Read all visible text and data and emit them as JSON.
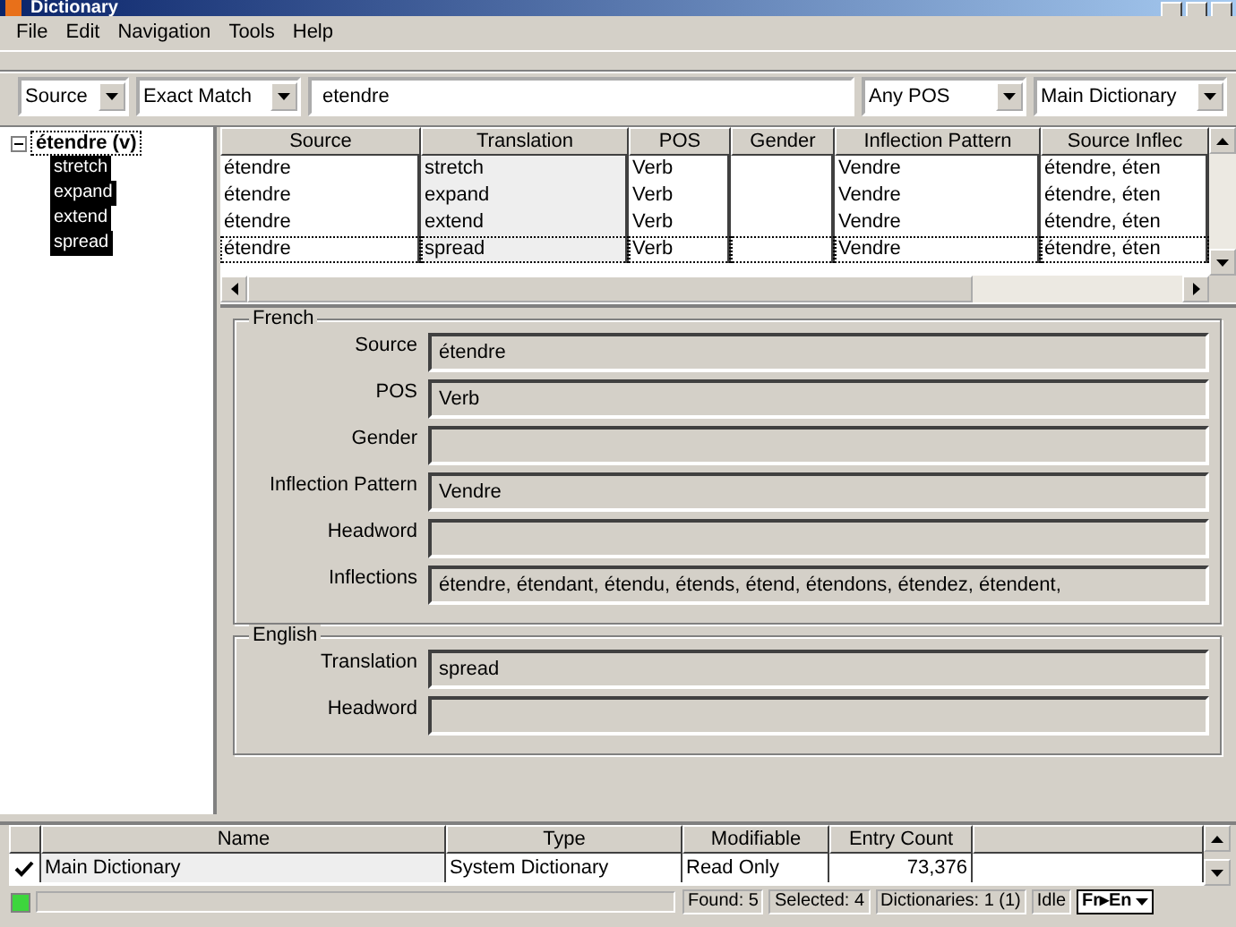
{
  "window": {
    "title": "Dictionary"
  },
  "menu": [
    "File",
    "Edit",
    "Navigation",
    "Tools",
    "Help"
  ],
  "search": {
    "field": "Source",
    "match": "Exact Match",
    "query": "etendre",
    "pos": "Any POS",
    "dictionary": "Main Dictionary"
  },
  "tree": {
    "label": "étendre (v)",
    "expanded": true,
    "children": [
      {
        "label": "stretch",
        "selected": true
      },
      {
        "label": "expand",
        "selected": true
      },
      {
        "label": "extend",
        "selected": true
      },
      {
        "label": "spread",
        "selected": true
      }
    ]
  },
  "results": {
    "columns": [
      "Source",
      "Translation",
      "POS",
      "Gender",
      "Inflection Pattern",
      "Source Inflec"
    ],
    "rows": [
      {
        "cells": [
          "étendre",
          "stretch",
          "Verb",
          null,
          "Vendre",
          "étendre, éten"
        ],
        "focused": false
      },
      {
        "cells": [
          "étendre",
          "expand",
          "Verb",
          null,
          "Vendre",
          "étendre, éten"
        ],
        "focused": false
      },
      {
        "cells": [
          "étendre",
          "extend",
          "Verb",
          null,
          "Vendre",
          "étendre, éten"
        ],
        "focused": false
      },
      {
        "cells": [
          "étendre",
          "spread",
          "Verb",
          null,
          "Vendre",
          "étendre, éten"
        ],
        "focused": true
      }
    ]
  },
  "groups": [
    {
      "title": "French",
      "fields": [
        {
          "label": "Source",
          "value": "étendre"
        },
        {
          "label": "POS",
          "value": "Verb"
        },
        {
          "label": "Gender"
        },
        {
          "label": "Inflection Pattern",
          "value": "Vendre"
        },
        {
          "label": "Headword"
        },
        {
          "label": "Inflections",
          "value": "étendre, étendant, étendu, étends, étend, étendons, étendez, étendent,"
        }
      ]
    },
    {
      "title": "English",
      "fields": [
        {
          "label": "Translation",
          "value": "spread"
        },
        {
          "label": "Headword"
        }
      ]
    }
  ],
  "dictionaries": {
    "columns": [
      "Name",
      "Type",
      "Modifiable",
      "Entry Count"
    ],
    "rows": [
      {
        "checked": true,
        "cells": [
          "Main Dictionary",
          "System Dictionary",
          "Read Only",
          "73,376"
        ]
      }
    ]
  },
  "status_bar": {
    "found": "Found: 5",
    "selected": "Selected: 4",
    "dictionaries": "Dictionaries: 1 (1)",
    "state": "Idle",
    "language": "Fr▸En"
  }
}
